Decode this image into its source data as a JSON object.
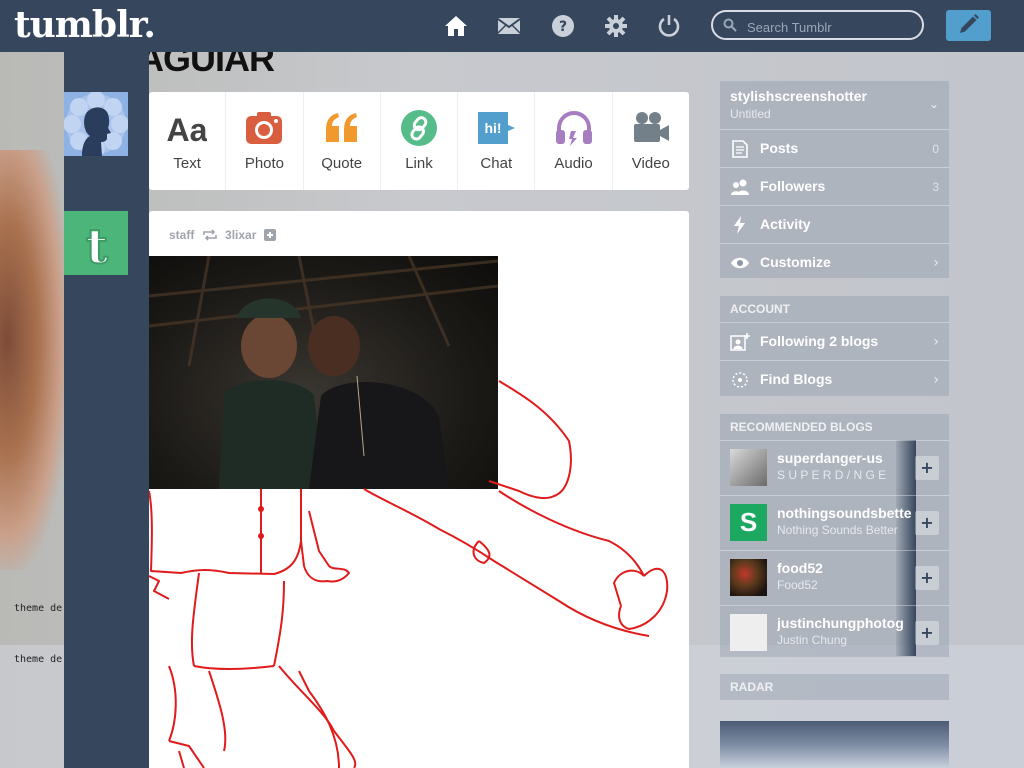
{
  "app": {
    "logo": "tumblr.",
    "search_placeholder": "Search Tumblr",
    "nav": [
      {
        "name": "home-icon",
        "label": "Dashboard"
      },
      {
        "name": "mail-icon",
        "label": "Inbox"
      },
      {
        "name": "help-icon",
        "label": "Help"
      },
      {
        "name": "gear-icon",
        "label": "Settings"
      },
      {
        "name": "power-icon",
        "label": "Log out"
      }
    ],
    "colors": {
      "bar": "#36465d",
      "accent": "#529ecc",
      "tumblr_green": "#4bb57a"
    }
  },
  "background": {
    "logo_text": "AGUIAR",
    "theme_credit": "theme de"
  },
  "composer": {
    "types": [
      {
        "label": "Text",
        "icon": "text-icon",
        "color": "#444444"
      },
      {
        "label": "Photo",
        "icon": "camera-icon",
        "color": "#d95e40"
      },
      {
        "label": "Quote",
        "icon": "quote-icon",
        "color": "#f2992e"
      },
      {
        "label": "Link",
        "icon": "link-icon",
        "color": "#56bc8a"
      },
      {
        "label": "Chat",
        "icon": "chat-icon",
        "color": "#529ecc",
        "badge": "hi!"
      },
      {
        "label": "Audio",
        "icon": "headphones-icon",
        "color": "#a77dc2"
      },
      {
        "label": "Video",
        "icon": "video-camera-icon",
        "color": "#748089"
      }
    ]
  },
  "post": {
    "author": "staff",
    "reblogged_from": "3lixar"
  },
  "sidebar": {
    "blog": {
      "name": "stylishscreenshotter",
      "title": "Untitled"
    },
    "stats": [
      {
        "label": "Posts",
        "count": "0",
        "icon": "posts-icon"
      },
      {
        "label": "Followers",
        "count": "3",
        "icon": "followers-icon"
      },
      {
        "label": "Activity",
        "count": "",
        "icon": "activity-icon"
      },
      {
        "label": "Customize",
        "count": "",
        "icon": "eye-icon"
      }
    ],
    "account": {
      "title": "ACCOUNT",
      "items": [
        {
          "label": "Following 2 blogs",
          "icon": "following-icon"
        },
        {
          "label": "Find Blogs",
          "icon": "find-blogs-icon"
        }
      ]
    },
    "recommended": {
      "title": "RECOMMENDED BLOGS",
      "blogs": [
        {
          "name": "superdanger-us",
          "subtitle": "S U P E R D / N G E",
          "avatar_color": "#8a8a8a"
        },
        {
          "name": "nothingsoundsbetter",
          "subtitle": "Nothing Sounds Better",
          "avatar_color": "#1da861"
        },
        {
          "name": "food52",
          "subtitle": "Food52",
          "avatar_color": "#3a2a22"
        },
        {
          "name": "justinchungphotog",
          "subtitle": "Justin Chung",
          "avatar_color": "#eeeeee"
        }
      ]
    },
    "radar": {
      "title": "RADAR"
    }
  }
}
